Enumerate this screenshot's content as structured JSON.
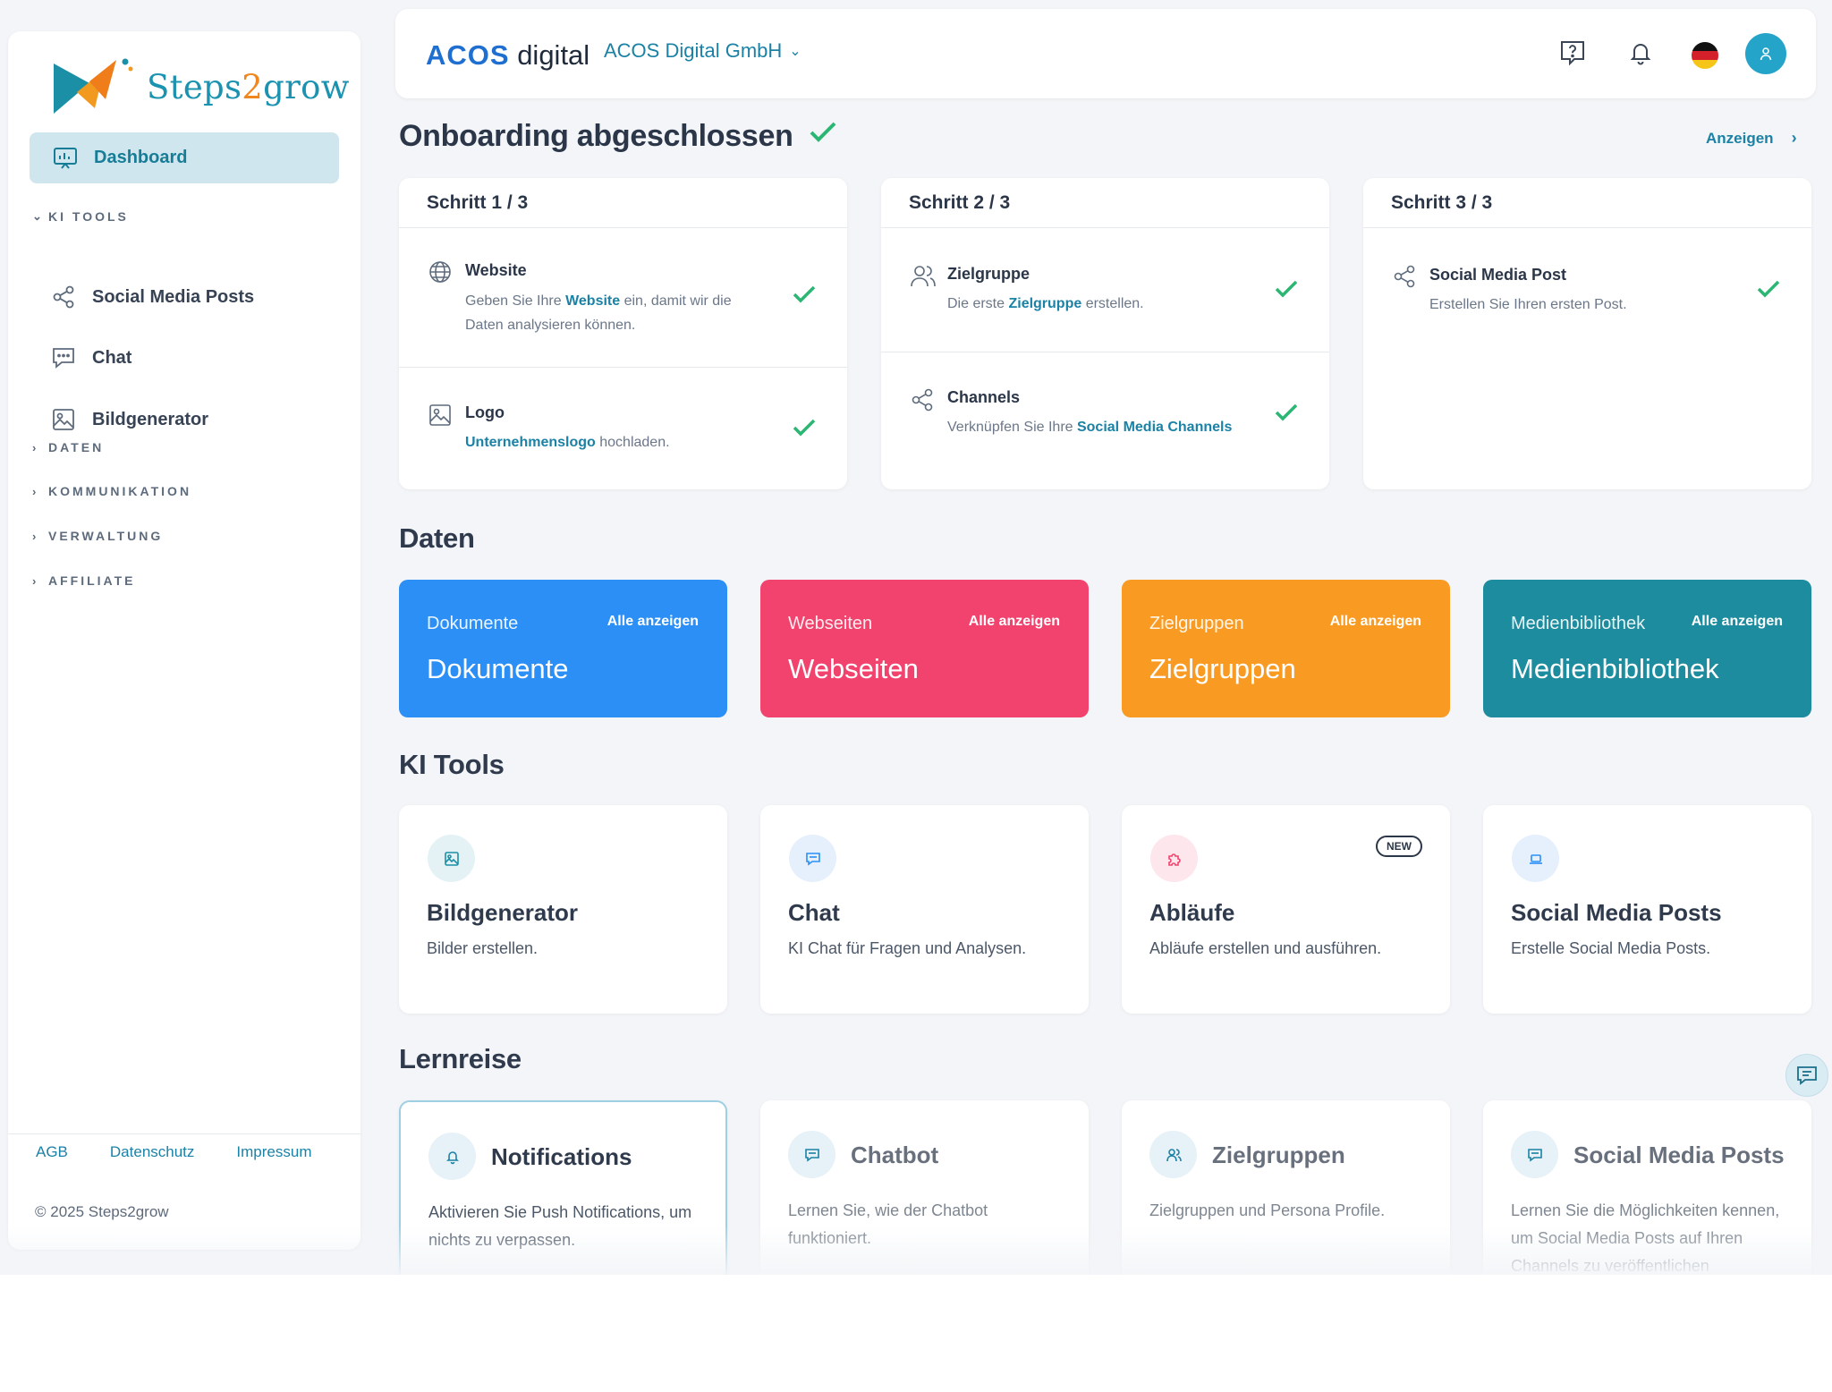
{
  "sidebar": {
    "logo_text_a": "Steps",
    "logo_text_b": "2",
    "logo_text_c": "grow",
    "active_item": "Dashboard",
    "sections": {
      "ki_tools": "KI TOOLS",
      "daten": "DATEN",
      "kommunikation": "KOMMUNIKATION",
      "verwaltung": "VERWALTUNG",
      "affiliate": "AFFILIATE"
    },
    "ki_items": [
      "Social Media Posts",
      "Chat",
      "Bildgenerator"
    ],
    "footer_links": [
      "AGB",
      "Datenschutz",
      "Impressum"
    ],
    "copyright": "© 2025 Steps2grow"
  },
  "header": {
    "brand_a": "ACOS",
    "brand_b": " digital",
    "company": "ACOS Digital GmbH"
  },
  "onboarding": {
    "title": "Onboarding abgeschlossen",
    "show_link": "Anzeigen",
    "steps": [
      {
        "label": "Schritt 1 / 3",
        "rows": [
          {
            "title": "Website",
            "desc_a": "Geben Sie Ihre ",
            "desc_link": "Website",
            "desc_b": " ein, damit wir die Daten analysieren können."
          },
          {
            "title": "Logo",
            "desc_a": "",
            "desc_link": "Unternehmenslogo",
            "desc_b": " hochladen."
          }
        ]
      },
      {
        "label": "Schritt 2 / 3",
        "rows": [
          {
            "title": "Zielgruppe",
            "desc_a": "Die erste ",
            "desc_link": "Zielgruppe",
            "desc_b": " erstellen."
          },
          {
            "title": "Channels",
            "desc_a": "Verknüpfen Sie Ihre ",
            "desc_link": "Social Media Channels",
            "desc_b": ""
          }
        ]
      },
      {
        "label": "Schritt 3 / 3",
        "rows": [
          {
            "title": "Social Media Post",
            "desc_a": "Erstellen Sie Ihren ersten Post.",
            "desc_link": "",
            "desc_b": ""
          }
        ]
      }
    ]
  },
  "daten": {
    "title": "Daten",
    "tiles": [
      {
        "small": "Dokumente",
        "all": "Alle anzeigen",
        "big": "Dokumente",
        "color": "#2b8ff6"
      },
      {
        "small": "Webseiten",
        "all": "Alle anzeigen",
        "big": "Webseiten",
        "color": "#f1436d"
      },
      {
        "small": "Zielgruppen",
        "all": "Alle anzeigen",
        "big": "Zielgruppen",
        "color": "#f99b23"
      },
      {
        "small": "Medienbibliothek",
        "all": "Alle anzeigen",
        "big": "Medienbibliothek",
        "color": "#1d8c9e"
      }
    ]
  },
  "ki_tools": {
    "title": "KI Tools",
    "badge": "NEW",
    "cards": [
      {
        "name": "Bildgenerator",
        "desc": "Bilder erstellen."
      },
      {
        "name": "Chat",
        "desc": "KI Chat für Fragen und Analysen."
      },
      {
        "name": "Abläufe",
        "desc": "Abläufe erstellen und ausführen."
      },
      {
        "name": "Social Media Posts",
        "desc": "Erstelle Social Media Posts."
      }
    ]
  },
  "lernreise": {
    "title": "Lernreise",
    "cards": [
      {
        "name": "Notifications",
        "desc": "Aktivieren Sie Push Notifications, um nichts zu verpassen."
      },
      {
        "name": "Chatbot",
        "desc": "Lernen Sie, wie der Chatbot funktioniert."
      },
      {
        "name": "Zielgruppen",
        "desc": "Zielgruppen und Persona Profile."
      },
      {
        "name": "Social Media Posts",
        "desc": "Lernen Sie die Möglichkeiten kennen, um Social Media Posts auf Ihren Channels zu veröffentlichen"
      }
    ]
  },
  "colors": {
    "accent": "#1b82a6",
    "success": "#2bb673",
    "background": "#f3f5f8"
  },
  "icons": [
    "dashboard-icon",
    "share-icon",
    "chat-icon",
    "image-icon",
    "help-icon",
    "bell-icon",
    "german-flag-icon",
    "user-icon",
    "globe-icon",
    "users-icon",
    "check-icon",
    "puzzle-icon",
    "laptop-icon",
    "chevron-down-icon",
    "chevron-right-icon"
  ]
}
